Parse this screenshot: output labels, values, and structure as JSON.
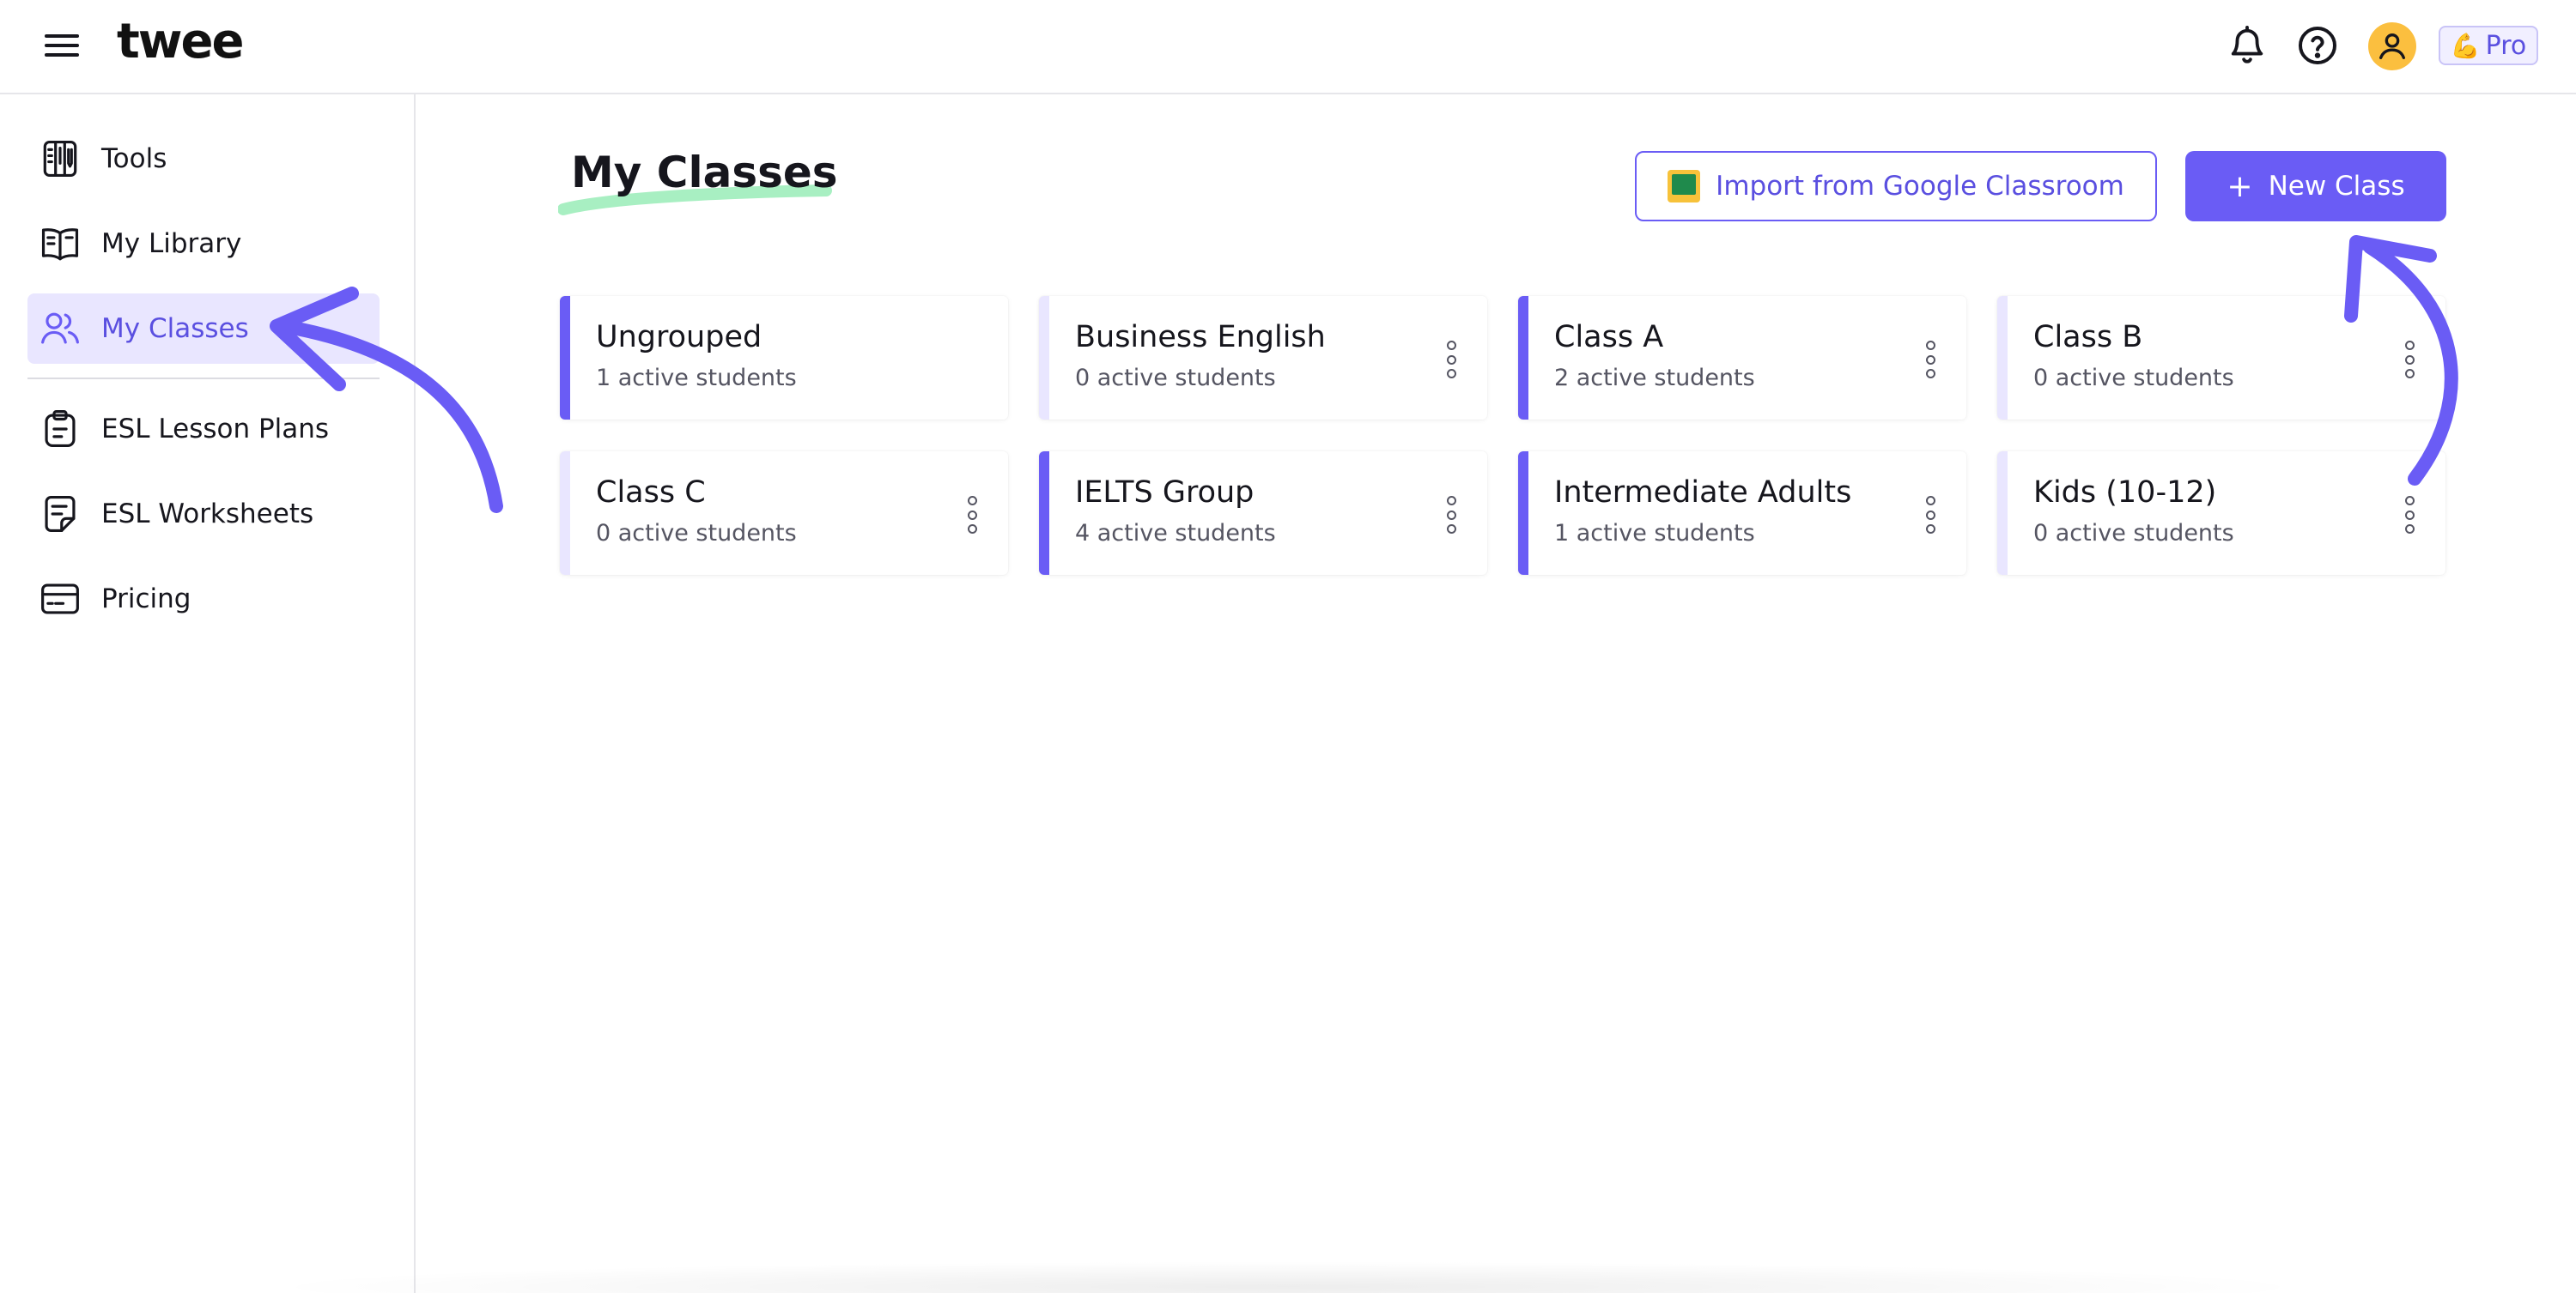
{
  "app": {
    "logo_text": "twee"
  },
  "header": {
    "pro_badge": {
      "emoji": "💪",
      "label": "Pro"
    },
    "icons": [
      "menu-icon",
      "bell-icon",
      "help-icon",
      "user-avatar-icon"
    ],
    "avatar_color": "#fbbf3f"
  },
  "sidebar": {
    "items": [
      {
        "label": "Tools",
        "icon": "tools-icon",
        "active": false
      },
      {
        "label": "My Library",
        "icon": "book-icon",
        "active": false
      },
      {
        "label": "My Classes",
        "icon": "users-icon",
        "active": true
      },
      {
        "label": "ESL Lesson Plans",
        "icon": "clipboard-icon",
        "active": false
      },
      {
        "label": "ESL Worksheets",
        "icon": "worksheet-icon",
        "active": false
      },
      {
        "label": "Pricing",
        "icon": "card-icon",
        "active": false
      }
    ]
  },
  "main": {
    "title": "My Classes",
    "import_button": "Import from Google Classroom",
    "new_class_button": "New Class",
    "classes": [
      {
        "name": "Ungrouped",
        "students": "1 active students",
        "accent": "solid",
        "menu": false
      },
      {
        "name": "Business English",
        "students": "0 active students",
        "accent": "light",
        "menu": true
      },
      {
        "name": "Class A",
        "students": "2 active students",
        "accent": "solid",
        "menu": true
      },
      {
        "name": "Class B",
        "students": "0 active students",
        "accent": "light",
        "menu": true
      },
      {
        "name": "Class C",
        "students": "0 active students",
        "accent": "light",
        "menu": true
      },
      {
        "name": "IELTS Group",
        "students": "4 active students",
        "accent": "solid",
        "menu": true
      },
      {
        "name": "Intermediate Adults",
        "students": "1 active students",
        "accent": "solid",
        "menu": true
      },
      {
        "name": "Kids (10-12)",
        "students": "0 active students",
        "accent": "light",
        "menu": true
      }
    ]
  },
  "colors": {
    "accent": "#6a5cf5",
    "accent_light": "#e9e6ff",
    "title_underline": "#a8efc2",
    "annotation_arrow": "#6a5cf5"
  }
}
